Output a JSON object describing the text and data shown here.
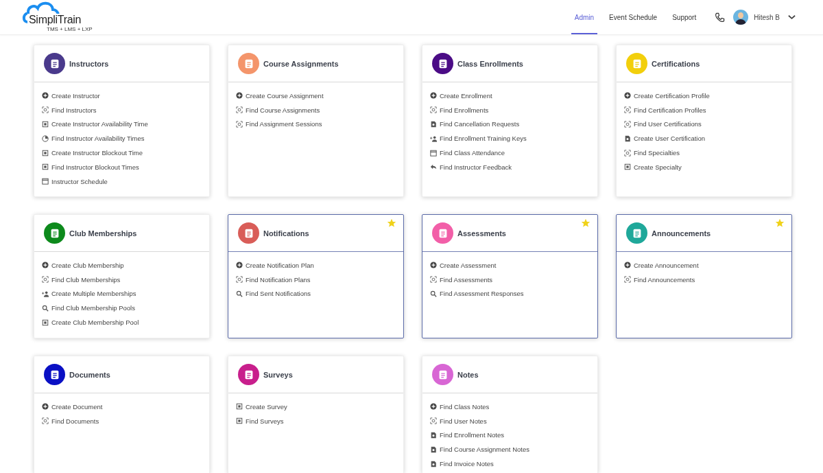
{
  "header": {
    "logo": {
      "name": "SimpliTrain",
      "tagline": "TMS + LMS + LXP"
    },
    "nav": [
      {
        "label": "Admin",
        "selected": true
      },
      {
        "label": "Event Schedule",
        "selected": false
      },
      {
        "label": "Support",
        "selected": false
      }
    ],
    "user": {
      "name": "Hitesh B"
    }
  },
  "cards": [
    {
      "title": "Instructors",
      "color": "#4a3a8c",
      "favorite": false,
      "items": [
        {
          "kind": "create",
          "label": "Create Instructor"
        },
        {
          "kind": "find",
          "label": "Find Instructors"
        },
        {
          "kind": "box",
          "label": "Create Instructor Availability Time"
        },
        {
          "kind": "clock",
          "label": "Find Instructor Availability Times"
        },
        {
          "kind": "box",
          "label": "Create Instructor Blockout Time"
        },
        {
          "kind": "box",
          "label": "Find Instructor Blockout Times"
        },
        {
          "kind": "calendar",
          "label": "Instructor Schedule"
        }
      ]
    },
    {
      "title": "Course Assignments",
      "color": "#f4956b",
      "favorite": false,
      "items": [
        {
          "kind": "create",
          "label": "Create Course Assignment"
        },
        {
          "kind": "find",
          "label": "Find Course Assignments"
        },
        {
          "kind": "find",
          "label": "Find Assignment Sessions"
        }
      ]
    },
    {
      "title": "Class Enrollments",
      "color": "#4b0c86",
      "favorite": false,
      "items": [
        {
          "kind": "create",
          "label": "Create Enrollment"
        },
        {
          "kind": "find",
          "label": "Find Enrollments"
        },
        {
          "kind": "doc",
          "label": "Find Cancellation Requests"
        },
        {
          "kind": "user",
          "label": "Find Enrollment Training Keys"
        },
        {
          "kind": "calendar",
          "label": "Find Class Attendance"
        },
        {
          "kind": "reply",
          "label": "Find Instructor Feedback"
        }
      ]
    },
    {
      "title": "Certifications",
      "color": "#f2cf0c",
      "favorite": false,
      "items": [
        {
          "kind": "create",
          "label": "Create Certification Profile"
        },
        {
          "kind": "find",
          "label": "Find Certification Profiles"
        },
        {
          "kind": "find",
          "label": "Find User Certifications"
        },
        {
          "kind": "doc",
          "label": "Create User Certification"
        },
        {
          "kind": "find",
          "label": "Find Specialties"
        },
        {
          "kind": "box",
          "label": "Create Specialty"
        }
      ]
    },
    {
      "title": "Club Memberships",
      "color": "#0d8a1c",
      "favorite": false,
      "items": [
        {
          "kind": "create",
          "label": "Create Club Membership"
        },
        {
          "kind": "find",
          "label": "Find Club Memberships"
        },
        {
          "kind": "user",
          "label": "Create Multiple Memberships"
        },
        {
          "kind": "search",
          "label": "Find Club Membership Pools"
        },
        {
          "kind": "box",
          "label": "Create Club Membership Pool"
        }
      ]
    },
    {
      "title": "Notifications",
      "color": "#d95d58",
      "favorite": true,
      "items": [
        {
          "kind": "create",
          "label": "Create Notification Plan"
        },
        {
          "kind": "find",
          "label": "Find Notification Plans"
        },
        {
          "kind": "search",
          "label": "Find Sent Notifications"
        }
      ]
    },
    {
      "title": "Assessments",
      "color": "#f25fa8",
      "favorite": true,
      "items": [
        {
          "kind": "create",
          "label": "Create Assessment"
        },
        {
          "kind": "find",
          "label": "Find Assessments"
        },
        {
          "kind": "search",
          "label": "Find Assessment Responses"
        }
      ]
    },
    {
      "title": "Announcements",
      "color": "#1fa89a",
      "favorite": true,
      "items": [
        {
          "kind": "create",
          "label": "Create Announcement"
        },
        {
          "kind": "find",
          "label": "Find Announcements"
        }
      ]
    },
    {
      "title": "Documents",
      "color": "#0a10c4",
      "favorite": false,
      "items": [
        {
          "kind": "create",
          "label": "Create Document"
        },
        {
          "kind": "find",
          "label": "Find Documents"
        }
      ]
    },
    {
      "title": "Surveys",
      "color": "#c81f8c",
      "favorite": false,
      "items": [
        {
          "kind": "box",
          "label": "Create Survey"
        },
        {
          "kind": "box",
          "label": "Find Surveys"
        }
      ]
    },
    {
      "title": "Notes",
      "color": "#d866d4",
      "favorite": false,
      "items": [
        {
          "kind": "create",
          "label": "Find Class Notes"
        },
        {
          "kind": "find",
          "label": "Find User Notes"
        },
        {
          "kind": "doc",
          "label": "Find Enrollment Notes"
        },
        {
          "kind": "doc",
          "label": "Find Course Assignment Notes"
        },
        {
          "kind": "doc",
          "label": "Find Invoice Notes"
        }
      ]
    }
  ]
}
